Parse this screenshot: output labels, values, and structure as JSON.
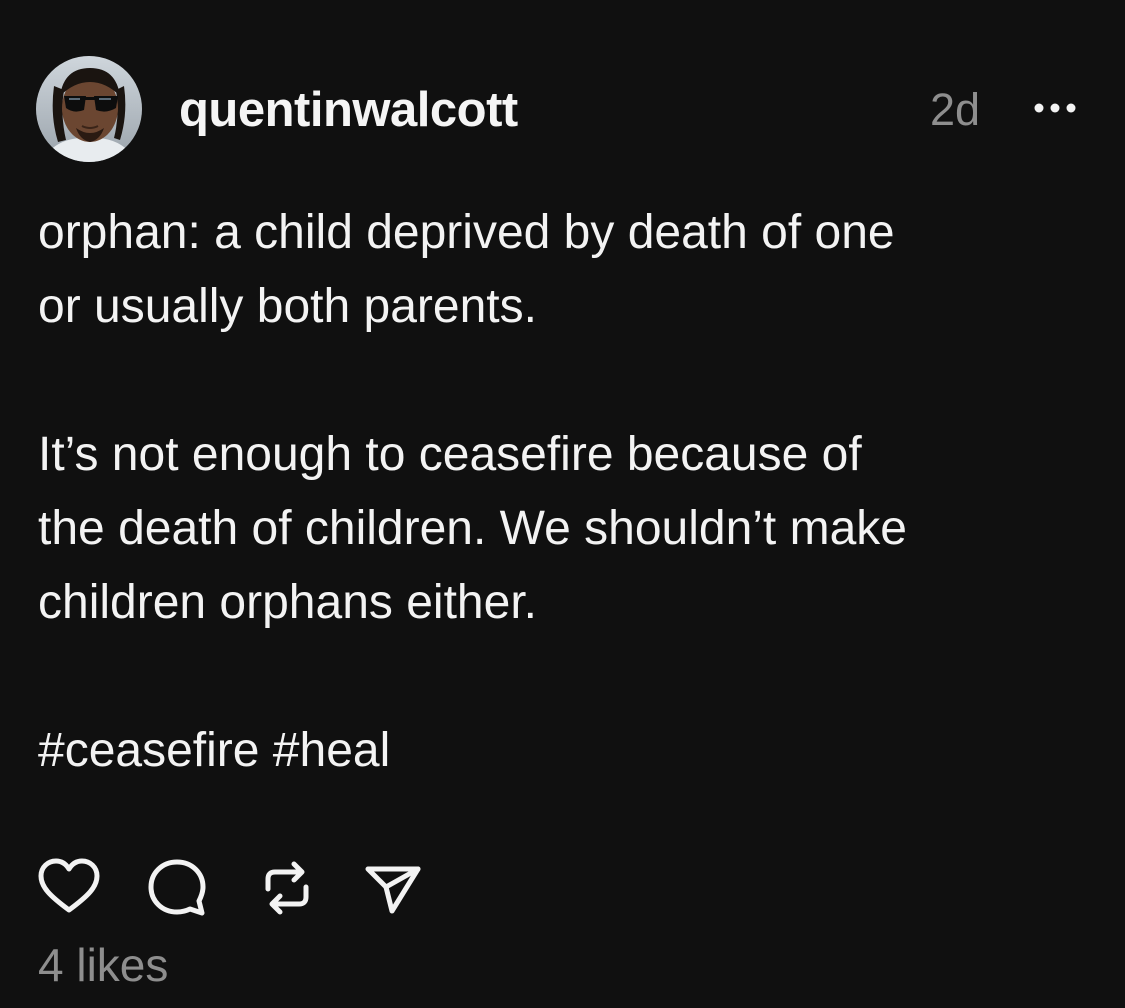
{
  "post": {
    "author": {
      "username": "quentinwalcott"
    },
    "timestamp": "2d",
    "body": {
      "paragraph_1_line_1": "orphan: a child deprived by death of one",
      "paragraph_1_line_2": "or usually both parents.",
      "paragraph_2_line_1": "It’s not enough to ceasefire because of",
      "paragraph_2_line_2": "the death of children. We shouldn’t make",
      "paragraph_2_line_3": "children orphans either.",
      "hashtags": "#ceasefire #heal"
    },
    "actions": {
      "like_icon": "heart-icon",
      "comment_icon": "comment-bubble-icon",
      "repost_icon": "repost-icon",
      "share_icon": "send-icon",
      "more_icon": "more-options-icon"
    },
    "likes_text": "4 likes"
  },
  "colors": {
    "background": "#101010",
    "text_primary": "#f3f3f3",
    "text_secondary": "#8e8e8e"
  }
}
